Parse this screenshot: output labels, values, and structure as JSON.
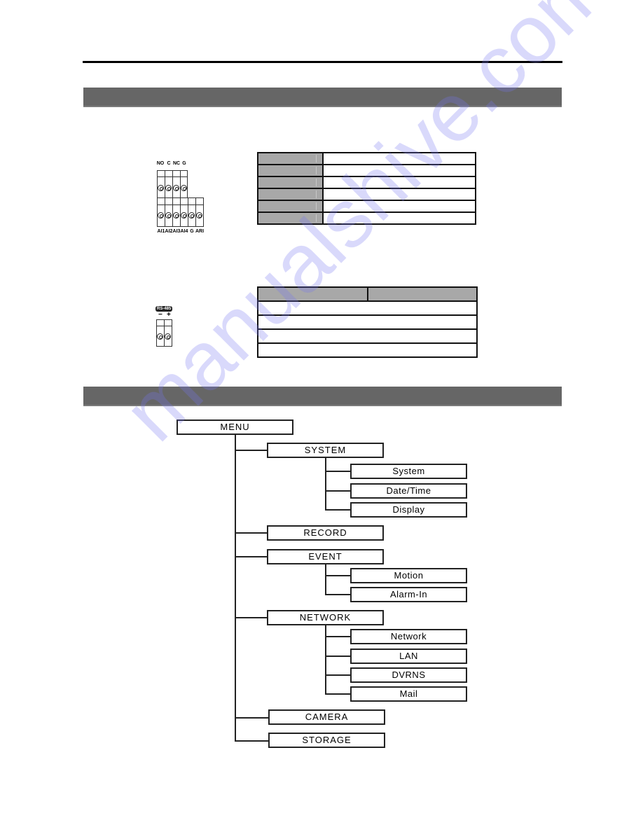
{
  "page": {
    "watermark": "manualshive.com",
    "colors": {
      "section_bar": "#666666",
      "table_header": "#a8a8a8",
      "watermark": "#7878f0"
    }
  },
  "alarm_connector": {
    "top_labels": [
      "NO",
      "C",
      "NC",
      "G"
    ],
    "bottom_labels": [
      "AI1",
      "AI2",
      "AI3",
      "AI4",
      "G",
      "ARI"
    ],
    "table_rows": 6
  },
  "rs485_connector": {
    "badge": "RS-485",
    "polarity": [
      "−",
      "+"
    ],
    "table_body_rows": 4
  },
  "menu_tree": {
    "root": "MENU",
    "items": [
      {
        "label": "SYSTEM",
        "children": [
          "System",
          "Date/Time",
          "Display"
        ]
      },
      {
        "label": "RECORD",
        "children": []
      },
      {
        "label": "EVENT",
        "children": [
          "Motion",
          "Alarm-In"
        ]
      },
      {
        "label": "NETWORK",
        "children": [
          "Network",
          "LAN",
          "DVRNS",
          "Mail"
        ]
      },
      {
        "label": "CAMERA",
        "children": []
      },
      {
        "label": "STORAGE",
        "children": []
      }
    ]
  }
}
